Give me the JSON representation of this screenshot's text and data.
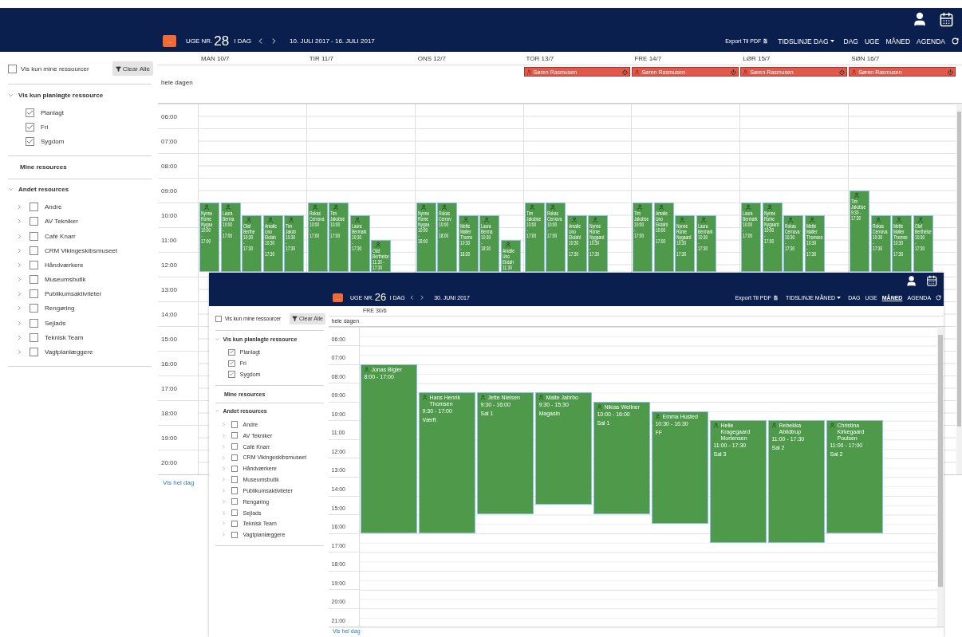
{
  "week_view": {
    "header": {
      "menu_button": "...",
      "week_prefix": "UGE NR.",
      "week_number": "28",
      "today": "I DAG",
      "date_range": "10. JULI 2017 - 16. JULI 2017",
      "export": "Export Til PDF",
      "timeline": "TIDSLINJE DAG",
      "views": [
        {
          "label": "DAG",
          "selected": false
        },
        {
          "label": "UGE",
          "selected": false
        },
        {
          "label": "MÅNED",
          "selected": false
        },
        {
          "label": "AGENDA",
          "selected": false
        }
      ]
    },
    "sidebar": {
      "only_mine": {
        "label": "Vis kun mine ressourcer",
        "checked": false
      },
      "clear_button": "Clear Alle",
      "planned": {
        "title": "Vis kun planlagte ressource",
        "expanded": true,
        "items": [
          {
            "label": "Planlagt",
            "checked": true
          },
          {
            "label": "Fri",
            "checked": true
          },
          {
            "label": "Sygdom",
            "checked": true
          }
        ]
      },
      "mine_resources": "Mine resources",
      "other": {
        "title": "Andet resources",
        "expanded": true,
        "items": [
          {
            "label": "Andre",
            "checked": false
          },
          {
            "label": "AV Tekniker",
            "checked": false
          },
          {
            "label": "Café Knarr",
            "checked": false
          },
          {
            "label": "CRM Vikingeskibsmuseet",
            "checked": false
          },
          {
            "label": "Håndværkere",
            "checked": false
          },
          {
            "label": "Museumsbutik",
            "checked": false
          },
          {
            "label": "Publikumsaktiviteter",
            "checked": false
          },
          {
            "label": "Rengøring",
            "checked": false
          },
          {
            "label": "Sejlads",
            "checked": false
          },
          {
            "label": "Teknisk Team",
            "checked": false
          },
          {
            "label": "Vagtplanlæggere",
            "checked": false
          }
        ]
      }
    },
    "calendar": {
      "all_day_label": "hele dagen",
      "show_full_day": "Vis hel dag",
      "hours": [
        "06:00",
        "07:00",
        "08:00",
        "09:00",
        "10:00",
        "11:00",
        "12:00",
        "13:00",
        "14:00",
        "15:00",
        "16:00",
        "17:00",
        "18:00",
        "19:00",
        "20:00"
      ],
      "days": [
        {
          "label": "MAN 10/7",
          "events": [
            {
              "lines": [
                "Nynne",
                "Rome",
                "Nygaa"
              ],
              "times": [
                "10:00",
                "-",
                "17:00"
              ]
            },
            {
              "lines": [
                "Laura",
                "Berma"
              ],
              "times": [
                "10:00",
                "-",
                "17:00"
              ]
            },
            {
              "lines": [
                "Olaf",
                "Berthe"
              ],
              "times": [
                "10:30",
                "-",
                "17:30"
              ]
            },
            {
              "lines": [
                "Amalie",
                "Uno",
                "Ekdah"
              ],
              "times": [
                "10:30",
                "-",
                "17:30"
              ]
            },
            {
              "lines": [
                "Tim",
                "Jakob"
              ],
              "times": [
                "10:30",
                "-",
                "17:30"
              ]
            }
          ]
        },
        {
          "label": "TIR 11/7",
          "events": [
            {
              "lines": [
                "Rokas",
                "Cernova"
              ],
              "times": [
                "10:00",
                "-",
                "17:00"
              ]
            },
            {
              "lines": [
                "Tim",
                "Jakobse"
              ],
              "times": [
                "10:00",
                "-",
                "17:00"
              ]
            },
            {
              "lines": [
                "Laura",
                "Bermark"
              ],
              "times": [
                "10:30",
                "-",
                "17:30"
              ]
            },
            {
              "lines": [
                "Olaf",
                "Berthelse"
              ],
              "times": [
                "11:30 -",
                "17:30"
              ]
            }
          ]
        },
        {
          "label": "ONS 12/7",
          "events": [
            {
              "lines": [
                "Nynne",
                "Rome",
                "Nygaa"
              ],
              "times": [
                "10:00",
                "-",
                "18:00"
              ]
            },
            {
              "lines": [
                "Rokas",
                "Cernov"
              ],
              "times": [
                "10:00",
                "-",
                "18:00"
              ]
            },
            {
              "lines": [
                "Mette",
                "Møller",
                "Thoms"
              ],
              "times": [
                "10:30",
                "-",
                "18:30"
              ]
            },
            {
              "lines": [
                "Laura",
                "Berma"
              ],
              "times": [
                "10:30",
                "-",
                "18:30"
              ]
            },
            {
              "lines": [
                "Amalie",
                "Uno",
                "Ekdah"
              ],
              "times": [
                "11:30"
              ]
            }
          ]
        },
        {
          "label": "TOR 13/7",
          "all_day_events": [
            {
              "name": "Søren Rasmusen"
            }
          ],
          "events": [
            {
              "lines": [
                "Tim",
                "Jakobse"
              ],
              "times": [
                "10:00",
                "-",
                "17:00"
              ]
            },
            {
              "lines": [
                "Rokas",
                "Cernova"
              ],
              "times": [
                "10:00",
                "-",
                "17:00"
              ]
            },
            {
              "lines": [
                "Amalie",
                "Uno",
                "Ekdahl"
              ],
              "times": [
                "10:30",
                "-",
                "17:30"
              ]
            },
            {
              "lines": [
                "Nynne",
                "Rome",
                "Nygaard"
              ],
              "times": [
                "10:30",
                "-",
                "17:30"
              ]
            }
          ]
        },
        {
          "label": "FRE 14/7",
          "all_day_events": [
            {
              "name": "Søren Rasmusen"
            }
          ],
          "events": [
            {
              "lines": [
                "Tim",
                "Jakobse"
              ],
              "times": [
                "10:00",
                "-",
                "17:00"
              ]
            },
            {
              "lines": [
                "Amalie",
                "Uno",
                "Ekdahl"
              ],
              "times": [
                "10:00",
                "-",
                "17:00"
              ]
            },
            {
              "lines": [
                "Nynne",
                "Rome",
                "Nygaard"
              ],
              "times": [
                "10:30",
                "-",
                "17:30"
              ]
            },
            {
              "lines": [
                "Laura",
                "Bermark"
              ],
              "times": [
                "10:30",
                "-",
                "17:30"
              ]
            }
          ]
        },
        {
          "label": "LØR 15/7",
          "all_day_events": [
            {
              "name": "Søren Rasmusen"
            }
          ],
          "events": [
            {
              "lines": [
                "Laura",
                "Bermark"
              ],
              "times": [
                "10:00",
                "-",
                "17:00"
              ]
            },
            {
              "lines": [
                "Nynne",
                "Rome",
                "Nygaard"
              ],
              "times": [
                "10:00",
                "-",
                "17:00"
              ]
            },
            {
              "lines": [
                "Rokas",
                "Cernova"
              ],
              "times": [
                "10:30",
                "-",
                "17:30"
              ]
            },
            {
              "lines": [
                "Mette",
                "Møller",
                "Thomsen"
              ],
              "times": [
                "10:30",
                "-",
                "17:30"
              ]
            }
          ]
        },
        {
          "label": "SØN 16/7",
          "all_day_events": [
            {
              "name": "Søren Rasmusen"
            }
          ],
          "events": [
            {
              "lines": [
                "Tim",
                "Jakobse"
              ],
              "times": [
                "9:30 -",
                "17:30"
              ]
            },
            {
              "lines": [
                "Rokas",
                "Cernova"
              ],
              "times": [
                "10:30",
                "-",
                "17:30"
              ]
            },
            {
              "lines": [
                "Mette",
                "Møller",
                "Thomse"
              ],
              "times": [
                "10:30",
                "-",
                "17:30"
              ]
            },
            {
              "lines": [
                "Olaf",
                "Berthelse"
              ],
              "times": [
                "10:30",
                "-",
                "17:30"
              ]
            }
          ]
        }
      ]
    }
  },
  "day_view": {
    "header": {
      "menu_button": "...",
      "week_prefix": "UGE NR.",
      "week_number": "26",
      "today": "I DAG",
      "date_range": "30. JUNI 2017",
      "export": "Export Til PDF",
      "timeline": "TIDSLINJE MÅNED",
      "views": [
        {
          "label": "DAG",
          "selected": false
        },
        {
          "label": "UGE",
          "selected": false
        },
        {
          "label": "MÅNED",
          "selected": true
        },
        {
          "label": "AGENDA",
          "selected": false
        }
      ]
    },
    "sidebar": {
      "only_mine": {
        "label": "Vis kun mine ressourcer",
        "checked": false
      },
      "clear_button": "Clear Alle",
      "planned": {
        "title": "Vis kun planlagte ressource",
        "expanded": true,
        "items": [
          {
            "label": "Planlagt",
            "checked": true
          },
          {
            "label": "Fri",
            "checked": true
          },
          {
            "label": "Sygdom",
            "checked": true
          }
        ]
      },
      "mine_resources": "Mine resources",
      "other": {
        "title": "Andet resources",
        "expanded": true,
        "items": [
          {
            "label": "Andre",
            "checked": false
          },
          {
            "label": "AV Tekniker",
            "checked": false
          },
          {
            "label": "Café Knarr",
            "checked": false
          },
          {
            "label": "CRM Vikingeskibsmuseet",
            "checked": false
          },
          {
            "label": "Håndværkere",
            "checked": false
          },
          {
            "label": "Museumsbutik",
            "checked": false
          },
          {
            "label": "Publikumsaktiviteter",
            "checked": false
          },
          {
            "label": "Rengøring",
            "checked": false
          },
          {
            "label": "Sejlads",
            "checked": false
          },
          {
            "label": "Teknisk Team",
            "checked": false
          },
          {
            "label": "Vagtplanlæggere",
            "checked": false
          }
        ]
      }
    },
    "calendar": {
      "all_day_label": "hele dagen",
      "show_full_day": "Vis hel dag",
      "hours": [
        "06:00",
        "07:00",
        "08:00",
        "09:00",
        "10:00",
        "11:00",
        "12:00",
        "13:00",
        "14:00",
        "15:00",
        "16:00",
        "17:00",
        "18:00",
        "19:00",
        "20:00",
        "21:00"
      ],
      "day": {
        "label": "FRE 30/6",
        "events": [
          {
            "name": "Jonas Bigler",
            "time": "8:00 - 17:00"
          },
          {
            "name": "Hans Henrik Thomsen",
            "time": "9:30 - 17:00",
            "note": "Værft"
          },
          {
            "name": "Jette Nielsen",
            "time": "9:30 - 16:00",
            "note": "Sal 1"
          },
          {
            "name": "Malte Jahrbo",
            "time": "9:30 - 15:30",
            "note": "Magasin"
          },
          {
            "name": "Niklas Wellner",
            "time": "10:00 - 16:00",
            "note": "Sal 1"
          },
          {
            "name": "Emma Husted",
            "time": "10:30 - 16:30",
            "note": "FF"
          },
          {
            "name": "Helle Kragegaard Mortensen",
            "time": "11:00 - 17:30",
            "note": "Sal 3"
          },
          {
            "name": "Rebekka Abildtrup",
            "time": "11:00 - 17:30",
            "note": "Sal 2"
          },
          {
            "name": "Christina Kirkegaard Poulsen",
            "time": "11:00 - 17:00",
            "note": "Sal 2"
          }
        ]
      }
    }
  }
}
